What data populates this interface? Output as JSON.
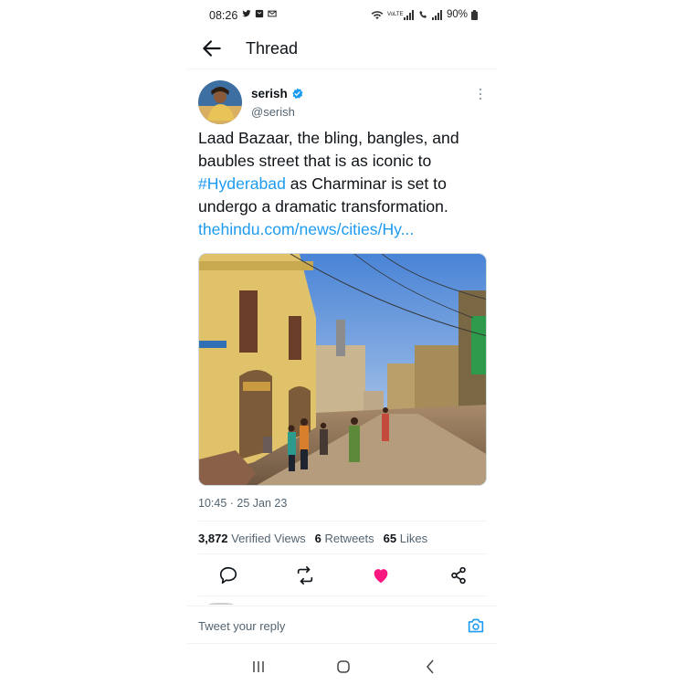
{
  "status_bar": {
    "time": "08:26",
    "left_icons": [
      "twitter-icon",
      "message-icon",
      "gmail-icon"
    ],
    "right_icons": [
      "wifi-icon",
      "volte-icon",
      "signal-icon",
      "call-icon",
      "signal-icon"
    ],
    "volte_label": "VoLTE",
    "battery": "90%"
  },
  "header": {
    "title": "Thread"
  },
  "tweet": {
    "author_name": "serish",
    "handle": "@serish",
    "text_part1": "Laad Bazaar, the bling, bangles, and baubles street that is as iconic to ",
    "hashtag": "#Hyderabad",
    "text_part2": " as Charminar is set to undergo a dramatic transformation.",
    "link": "thehindu.com/news/cities/Hy...",
    "timestamp": "10:45 · 25 Jan 23",
    "stats": {
      "views_count": "3,872",
      "views_label": "Verified Views",
      "retweets_count": "6",
      "retweets_label": "Retweets",
      "likes_count": "65",
      "likes_label": "Likes"
    },
    "liked": true
  },
  "reply": {
    "placeholder": "Tweet your reply"
  },
  "colors": {
    "accent": "#1d9bf0",
    "like": "#f91880",
    "text": "#0f1419",
    "secondary": "#536471"
  }
}
